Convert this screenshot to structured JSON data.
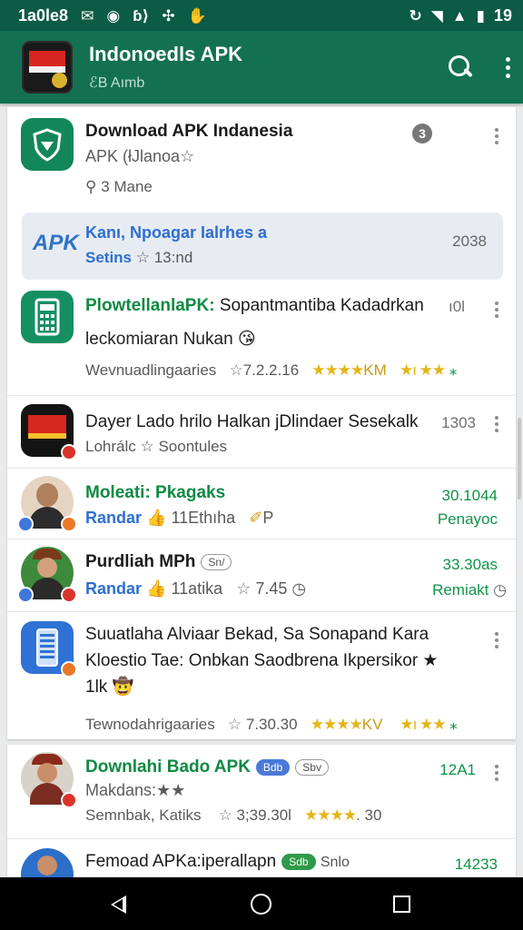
{
  "status_bar": {
    "time": "1a0le8",
    "battery": "19",
    "icons": [
      "message-icon",
      "opera-icon",
      "translate-icon",
      "fan-icon",
      "hand-icon",
      "sync-icon",
      "wifi-icon",
      "signal-icon",
      "battery-icon"
    ]
  },
  "app_bar": {
    "title": "Indonoedls APK",
    "subtitle": "ℰB Aımb"
  },
  "list": [
    {
      "title": "Download APK Indanesia",
      "line2": "APK (łJlanoa☆",
      "line3": "3 Mane",
      "badge": "3"
    },
    {
      "ad_label": "APK",
      "line1": "Kanı, Npoagar Ialrhes a",
      "line2_a": "Setins",
      "line2_b": "☆ 13:nd",
      "right": "2038"
    },
    {
      "title": "PlowtellanlaPK:",
      "title_rest": "Sopantmantiba Kadadrkan",
      "right": "ı0l",
      "line2": "leckomiaran Nukan 😘",
      "line3": "Wevnuadlingaaries",
      "rating": "7.2.2.16",
      "stars_a": "★★★★",
      "stars_a_suffix": "KM",
      "stars_b": "★ı ★★",
      "stars_b_suffix": "⁎"
    },
    {
      "title": "Dayer Lado hrilo Halkan jDlindaer Sesekalk",
      "right": "1303",
      "line2": "Lohrálc ☆ Soontules"
    },
    {
      "title": "Moleati: Pkagaks",
      "right": "30.1044",
      "line2_a": "Randar",
      "line2_b": "11Ethıha",
      "line2_c": "P",
      "right2": "Penayoc"
    },
    {
      "title": "Purdliah MPh",
      "tag": "Sn/",
      "right": "33.30as",
      "line2_a": "Randar",
      "line2_b": "11atika",
      "line2_c": "7.45",
      "right2": "Remiakt"
    },
    {
      "title": "Suuatlaha Alviaar Bekad, Sa Sonapand Kara",
      "line2": "Kloestio Tae: Onbkan Saodbrena Ikpersikor ★",
      "line3": "1lk 🤠",
      "line4": "Tewnodahrigaaries",
      "rating": "7.30.30",
      "stars_a": "★★★★",
      "stars_a_suffix": "KV",
      "stars_b": "★ı ★★",
      "stars_b_suffix": "⁎"
    }
  ],
  "list2": [
    {
      "title": "Downlahi Bado APK",
      "tag1": "Bdb",
      "tag2": "Sbv",
      "right": "12A1",
      "line2": "Makdans:★★",
      "line3_a": "Semnbak, Katiks",
      "rating": "3;39.30l",
      "stars": "★★★★",
      "stars_suffix": ". 30"
    },
    {
      "title": "Femoad APKa:iperallapn",
      "tag": "Sdb",
      "title_suffix": "Snlo",
      "right": "14233"
    }
  ],
  "colors": {
    "status_bar": "#0c5b45",
    "app_bar": "#137152",
    "accent_green": "#0f8a43",
    "accent_blue": "#2e6fd0",
    "star": "#e4b516"
  }
}
